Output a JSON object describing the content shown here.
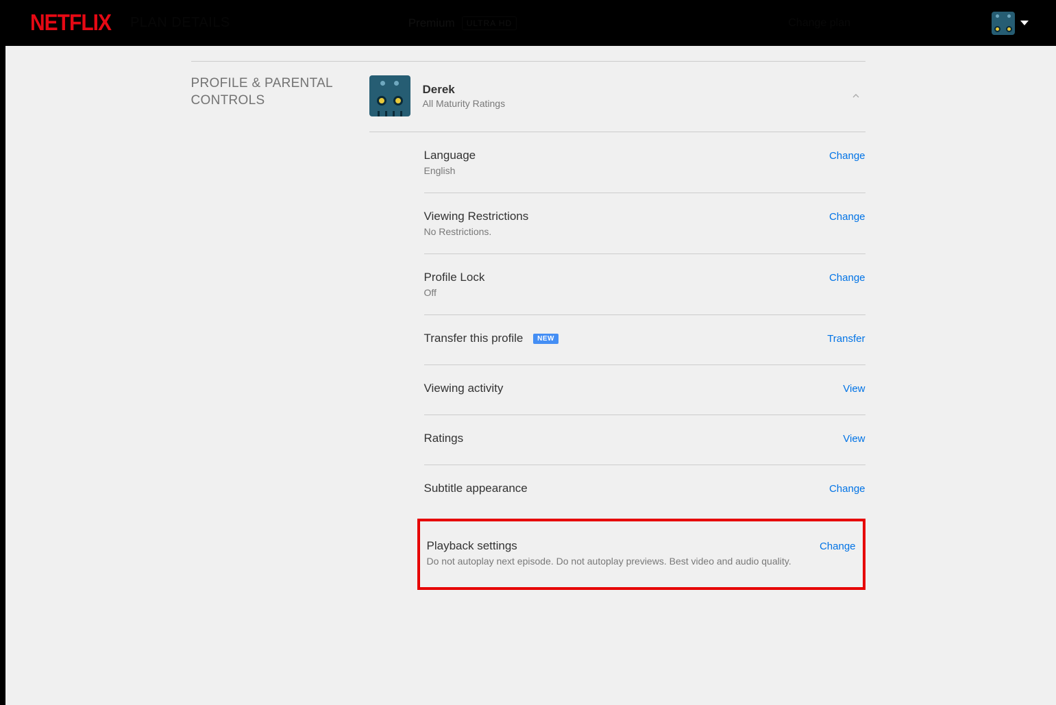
{
  "brand": "NETFLIX",
  "plan": {
    "label": "PLAN DETAILS",
    "tier": "Premium",
    "badge": "ULTRA HD",
    "change": "Change plan"
  },
  "section_label": "PROFILE & PARENTAL CONTROLS",
  "profile": {
    "name": "Derek",
    "maturity": "All Maturity Ratings"
  },
  "actions": {
    "change": "Change",
    "view": "View",
    "transfer": "Transfer"
  },
  "pill_new": "NEW",
  "items": {
    "language": {
      "title": "Language",
      "sub": "English"
    },
    "restrict": {
      "title": "Viewing Restrictions",
      "sub": "No Restrictions."
    },
    "lock": {
      "title": "Profile Lock",
      "sub": "Off"
    },
    "transfer": {
      "title": "Transfer this profile"
    },
    "activity": {
      "title": "Viewing activity"
    },
    "ratings": {
      "title": "Ratings"
    },
    "subtitle": {
      "title": "Subtitle appearance"
    },
    "playback": {
      "title": "Playback settings",
      "sub": "Do not autoplay next episode. Do not autoplay previews. Best video and audio quality."
    }
  }
}
